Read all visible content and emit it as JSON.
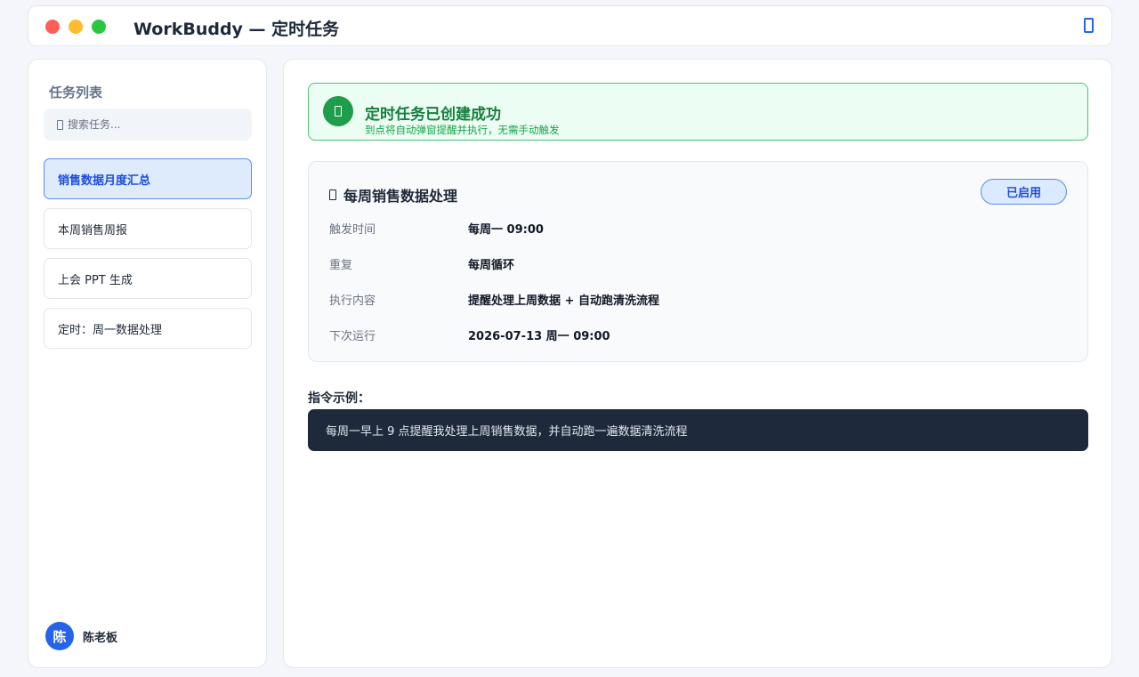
{
  "window": {
    "title": "WorkBuddy — 定时任务",
    "controls": [
      "close",
      "minimize",
      "maximize"
    ],
    "right_icon": "app-icon"
  },
  "sidebar": {
    "title": "任务列表",
    "search": {
      "placeholder": "搜索任务...",
      "value": ""
    },
    "items": [
      {
        "label": "销售数据月度汇总",
        "active": true
      },
      {
        "label": "本周销售周报",
        "active": false
      },
      {
        "label": "上会 PPT 生成",
        "active": false
      },
      {
        "label": "定时：周一数据处理",
        "active": false
      }
    ],
    "user": {
      "avatar_text": "陈",
      "name": "陈老板"
    }
  },
  "banner": {
    "title": "定时任务已创建成功",
    "subtitle": "到点将自动弹窗提醒并执行，无需手动触发",
    "icon": "success-icon"
  },
  "task": {
    "title": "每周销售数据处理",
    "status": "已启用",
    "rows": [
      {
        "label": "触发时间",
        "value": "每周一 09:00"
      },
      {
        "label": "重复",
        "value": "每周循环"
      },
      {
        "label": "执行内容",
        "value": "提醒处理上周数据 + 自动跑清洗流程"
      },
      {
        "label": "下次运行",
        "value": "2026-07-13 周一 09:00"
      }
    ]
  },
  "example": {
    "label": "指令示例：",
    "text": "每周一早上 9 点提醒我处理上周销售数据，并自动跑一遍数据清洗流程"
  },
  "colors": {
    "accent": "#2563eb",
    "success": "#16a34a",
    "success_bg": "#ecfdf3",
    "dark": "#1e293b"
  }
}
